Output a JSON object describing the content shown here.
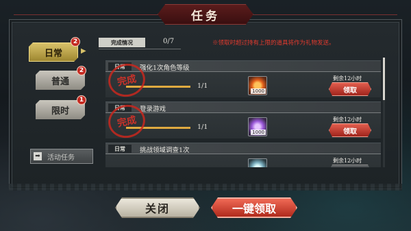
{
  "title": "任务",
  "tabs": [
    {
      "label": "日常",
      "badge": "2",
      "active": true
    },
    {
      "label": "普通",
      "badge": "2",
      "active": false
    },
    {
      "label": "限时",
      "badge": "1",
      "active": false
    }
  ],
  "activity_button": {
    "label": "活动任务",
    "icon": "arrow-right-icon"
  },
  "completion": {
    "label": "完成情况",
    "count": "0/7"
  },
  "notice": "※领取时超过持有上限的道具将作为礼物发送。",
  "tasks": [
    {
      "tag": "日常",
      "title": "强化1次角色等级",
      "progress": "1/1",
      "progress_fraction": 1.0,
      "reward_icon": "fire-orb-icon",
      "reward_count": "1000",
      "remaining": "剩余12小时",
      "button": "领取",
      "stamp": "完成"
    },
    {
      "tag": "日常",
      "title": "登录游戏",
      "progress": "1/1",
      "progress_fraction": 1.0,
      "reward_icon": "purple-crystal-icon",
      "reward_count": "1000",
      "remaining": "剩余12小时",
      "button": "领取",
      "stamp": "完成"
    },
    {
      "tag": "日常",
      "title": "挑战领域调查1次",
      "progress": "",
      "reward_icon": "blue-item-icon",
      "reward_count": "",
      "remaining": "剩余12小时",
      "button": "",
      "stamp": ""
    }
  ],
  "buttons": {
    "close": "关闭",
    "claim_all": "一键领取"
  },
  "colors": {
    "accent_red": "#e23a2e",
    "tab_gold": "#d9c26a"
  }
}
